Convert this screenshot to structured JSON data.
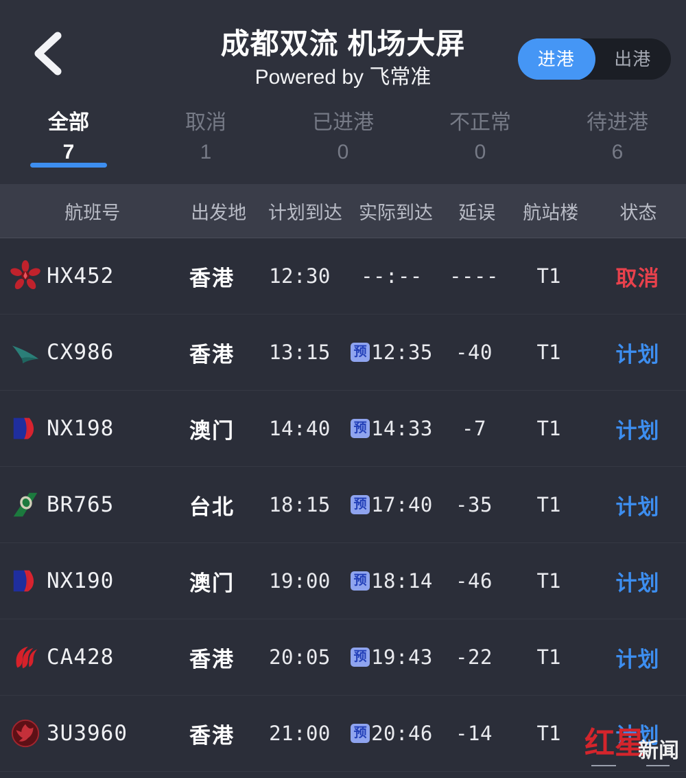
{
  "header": {
    "back_icon": "chevron-left-icon",
    "title": "成都双流 机场大屏",
    "subtitle": "Powered by 飞常准",
    "toggle": {
      "arrival_label": "进港",
      "departure_label": "出港",
      "active": "进港"
    },
    "accent_color": "#4596f5"
  },
  "tabs": [
    {
      "label": "全部",
      "count": "7",
      "active": true
    },
    {
      "label": "取消",
      "count": "1",
      "active": false
    },
    {
      "label": "已进港",
      "count": "0",
      "active": false
    },
    {
      "label": "不正常",
      "count": "0",
      "active": false
    },
    {
      "label": "待进港",
      "count": "6",
      "active": false
    }
  ],
  "columns": [
    "航班号",
    "出发地",
    "计划到达",
    "实际到达",
    "延误",
    "航站楼",
    "状态"
  ],
  "estimated_badge": "预",
  "status_colors": {
    "cancel": "#e8414c",
    "plan": "#3d8ef0"
  },
  "flights": [
    {
      "airline_icon": "hong-kong-airlines-logo",
      "flight_no": "HX452",
      "origin": "香港",
      "scheduled": "12:30",
      "actual": "--:--",
      "actual_estimated": false,
      "delay": "----",
      "terminal": "T1",
      "status": "取消",
      "status_type": "cancel"
    },
    {
      "airline_icon": "cathay-pacific-logo",
      "flight_no": "CX986",
      "origin": "香港",
      "scheduled": "13:15",
      "actual": "12:35",
      "actual_estimated": true,
      "delay": "-40",
      "terminal": "T1",
      "status": "计划",
      "status_type": "plan"
    },
    {
      "airline_icon": "air-macau-logo",
      "flight_no": "NX198",
      "origin": "澳门",
      "scheduled": "14:40",
      "actual": "14:33",
      "actual_estimated": true,
      "delay": "-7",
      "terminal": "T1",
      "status": "计划",
      "status_type": "plan"
    },
    {
      "airline_icon": "eva-air-logo",
      "flight_no": "BR765",
      "origin": "台北",
      "scheduled": "18:15",
      "actual": "17:40",
      "actual_estimated": true,
      "delay": "-35",
      "terminal": "T1",
      "status": "计划",
      "status_type": "plan"
    },
    {
      "airline_icon": "air-macau-logo",
      "flight_no": "NX190",
      "origin": "澳门",
      "scheduled": "19:00",
      "actual": "18:14",
      "actual_estimated": true,
      "delay": "-46",
      "terminal": "T1",
      "status": "计划",
      "status_type": "plan"
    },
    {
      "airline_icon": "air-china-logo",
      "flight_no": "CA428",
      "origin": "香港",
      "scheduled": "20:05",
      "actual": "19:43",
      "actual_estimated": true,
      "delay": "-22",
      "terminal": "T1",
      "status": "计划",
      "status_type": "plan"
    },
    {
      "airline_icon": "sichuan-airlines-logo",
      "flight_no": "3U3960",
      "origin": "香港",
      "scheduled": "21:00",
      "actual": "20:46",
      "actual_estimated": true,
      "delay": "-14",
      "terminal": "T1",
      "status": "计划",
      "status_type": "plan"
    }
  ],
  "watermark": {
    "text_red": "红星",
    "text_white": "新闻"
  }
}
